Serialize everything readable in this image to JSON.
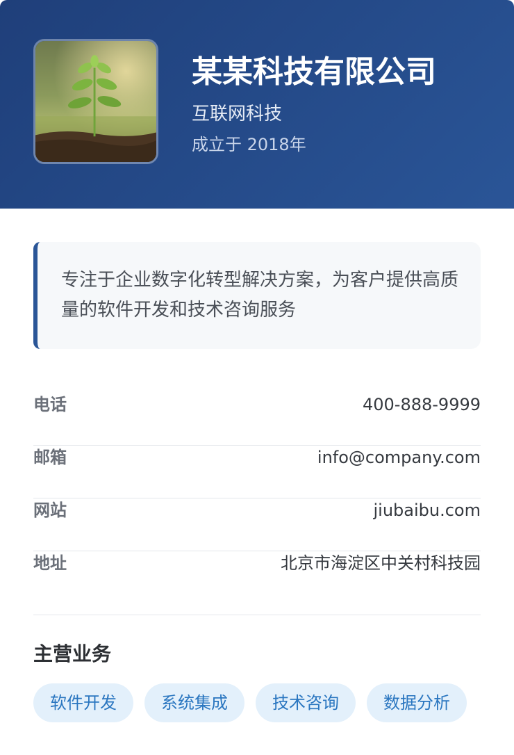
{
  "company": {
    "name": "某某科技有限公司",
    "industry": "互联网科技",
    "founded": "成立于 2018年",
    "logo_icon": "seedling-icon"
  },
  "description": "专注于企业数字化转型解决方案，为客户提供高质量的软件开发和技术咨询服务",
  "contact": {
    "phone": {
      "label": "电话",
      "value": "400-888-9999"
    },
    "email": {
      "label": "邮箱",
      "value": "info@company.com"
    },
    "website": {
      "label": "网站",
      "value": "jiubaibu.com"
    },
    "address": {
      "label": "地址",
      "value": "北京市海淀区中关村科技园"
    }
  },
  "business": {
    "title": "主营业务",
    "tags": [
      "软件开发",
      "系统集成",
      "技术咨询",
      "数据分析"
    ]
  },
  "colors": {
    "header_start": "#1f3f7a",
    "header_end": "#2a5597",
    "tag_bg": "#e3f0fb",
    "tag_text": "#2a76c0"
  }
}
